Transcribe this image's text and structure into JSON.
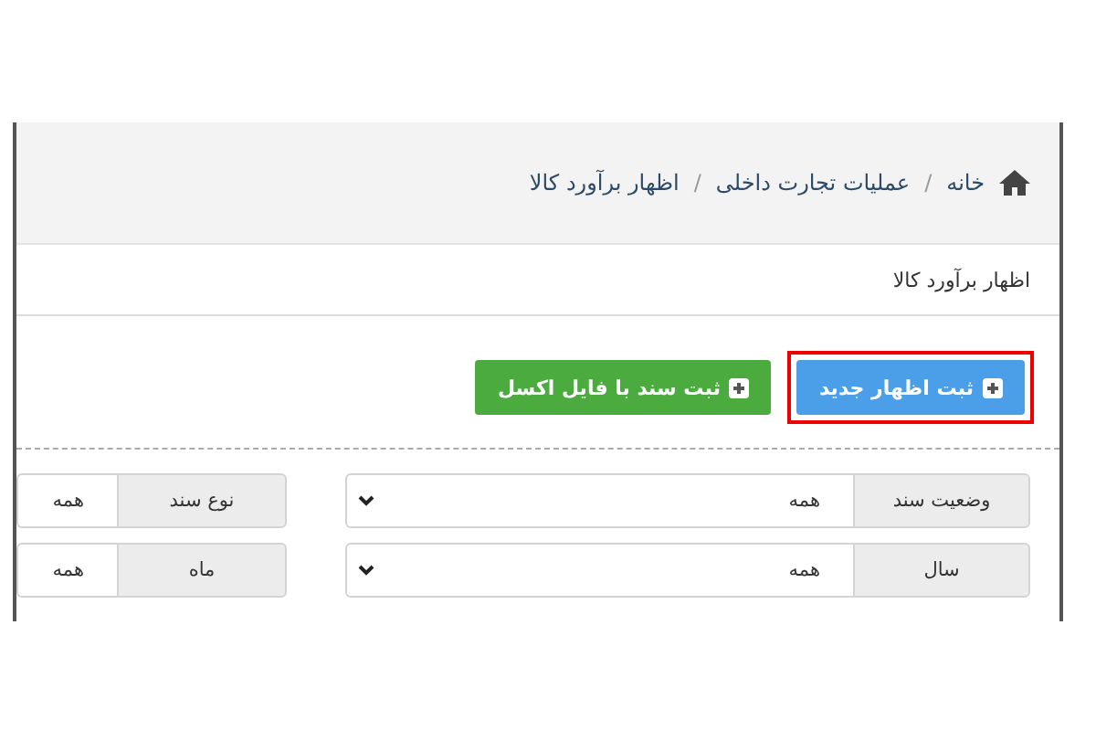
{
  "breadcrumb": [
    {
      "label": "خانه",
      "kind": "home"
    },
    {
      "separator": "/",
      "label": "عملیات تجارت داخلی",
      "kind": "link"
    },
    {
      "separator": "/",
      "label": "اظهار برآورد کالا",
      "kind": "link"
    }
  ],
  "page_title": "اظهار برآورد کالا",
  "actions": [
    {
      "label": "ثبت اظهار جدید",
      "color": "#4a9fe8",
      "highlighted": true
    },
    {
      "label": "ثبت سند با فایل اکسل",
      "color": "#4cab3e",
      "highlighted": false
    }
  ],
  "filters": [
    [
      {
        "label": "وضعیت سند",
        "value": "همه",
        "kind": "select"
      },
      {
        "label": "نوع سند",
        "value": "همه",
        "kind": "text"
      }
    ],
    [
      {
        "label": "سال",
        "value": "همه",
        "kind": "select"
      },
      {
        "label": "ماه",
        "value": "همه",
        "kind": "text"
      }
    ]
  ]
}
